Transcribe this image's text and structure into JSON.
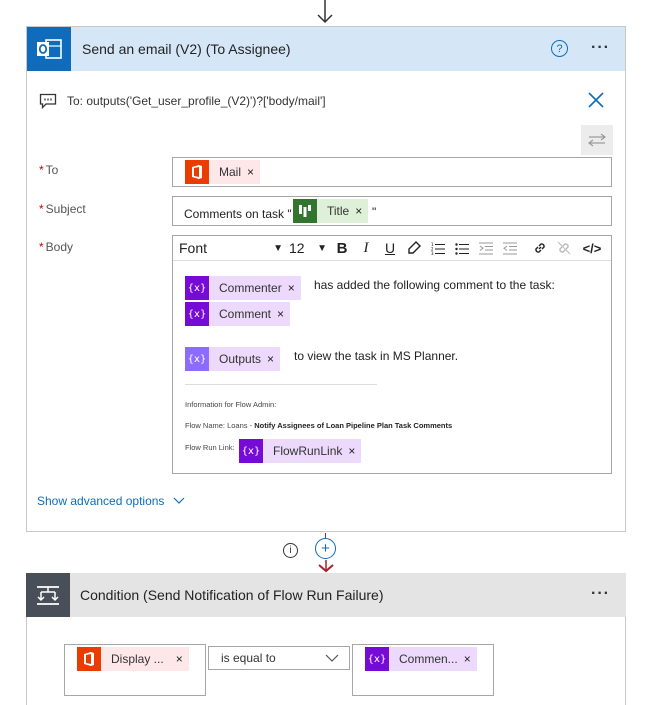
{
  "card1": {
    "title": "Send an email (V2) (To Assignee)",
    "help_glyph": "?",
    "more_glyph": "···",
    "header_bg": "#d5e7f6",
    "accent": "#0f6cbd",
    "to_line_text": "To: outputs('Get_user_profile_(V2)')?['body/mail']",
    "to_label": "To",
    "subject_label": "Subject",
    "body_label": "Body",
    "required_mark": "*",
    "to_token": {
      "label": "Mail",
      "x": "×",
      "icon": "office-icon",
      "color": "#eb3c00",
      "bg": "#fde7e9"
    },
    "subject_prefix": "Comments on task \"",
    "subject_suffix": "\"",
    "subject_token": {
      "label": "Title",
      "x": "×",
      "icon": "planner-icon",
      "color": "#31752f",
      "bg": "#dff0d8"
    },
    "toolbar": {
      "font_label": "Font",
      "size_label": "12",
      "bold": "B",
      "italic": "I",
      "underline": "U",
      "code": "</>"
    },
    "body": {
      "commenter_token": {
        "label": "Commenter",
        "x": "×",
        "icon_text": "{x}"
      },
      "line1_text": "has added the following comment to the task:",
      "comment_token": {
        "label": "Comment",
        "x": "×",
        "icon_text": "{x}"
      },
      "outputs_token": {
        "label": "Outputs",
        "x": "×",
        "icon_text": "{x}"
      },
      "line2_text": "to view the task in MS Planner.",
      "info_heading": "Information for Flow Admin:",
      "flow_name_prefix": "Flow Name: Loans - ",
      "flow_name_bold": "Notify Assignees of Loan Pipeline Plan Task Comments",
      "flow_run_link_label": "Flow Run Link:",
      "flowrunlink_token": {
        "label": "FlowRunLink",
        "x": "×",
        "icon_text": "{x}"
      }
    },
    "show_advanced": "Show advanced options",
    "var_color": "#770bd6",
    "var_bg": "#ecd9fb",
    "expr_color": "#8c6cff"
  },
  "connector": {
    "info_glyph": "i",
    "plus_glyph": "+"
  },
  "card2": {
    "title": "Condition (Send Notification of Flow Run Failure)",
    "more_glyph": "···",
    "header_bg": "#e4e4e4",
    "left_token": {
      "label": "Display ...",
      "x": "×"
    },
    "operator": "is equal to",
    "right_token": {
      "label": "Commen...",
      "x": "×",
      "icon_text": "{x}"
    }
  }
}
